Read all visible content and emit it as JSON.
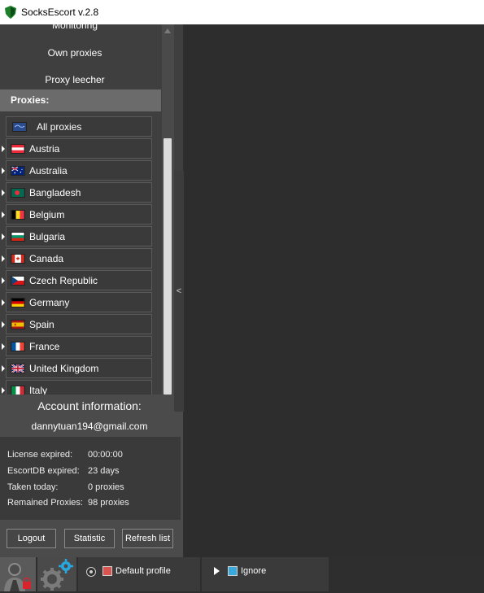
{
  "window": {
    "title": "SocksEscort v.2.8",
    "icon": "shield-icon"
  },
  "nav": {
    "items": [
      {
        "label": "Monitoring"
      },
      {
        "label": "Own proxies"
      },
      {
        "label": "Proxy leecher"
      }
    ]
  },
  "proxies": {
    "header": "Proxies:",
    "items": [
      {
        "label": "All proxies",
        "flag": "globe"
      },
      {
        "label": "Austria",
        "flag": "at"
      },
      {
        "label": "Australia",
        "flag": "au"
      },
      {
        "label": "Bangladesh",
        "flag": "bd"
      },
      {
        "label": "Belgium",
        "flag": "be"
      },
      {
        "label": "Bulgaria",
        "flag": "bg"
      },
      {
        "label": "Canada",
        "flag": "ca"
      },
      {
        "label": "Czech Republic",
        "flag": "cz"
      },
      {
        "label": "Germany",
        "flag": "de"
      },
      {
        "label": "Spain",
        "flag": "es"
      },
      {
        "label": "France",
        "flag": "fr"
      },
      {
        "label": "United Kingdom",
        "flag": "gb"
      },
      {
        "label": "Italy",
        "flag": "it"
      }
    ]
  },
  "splitter": {
    "glyph": "<"
  },
  "account": {
    "title": "Account information:",
    "email": "dannytuan194@gmail.com",
    "stats": [
      {
        "key": "License expired:",
        "value": "00:00:00"
      },
      {
        "key": "EscortDB expired:",
        "value": "23 days"
      },
      {
        "key": "Taken today:",
        "value": "0 proxies"
      },
      {
        "key": "Remained Proxies:",
        "value": "98 proxies"
      }
    ],
    "buttons": {
      "logout": "Logout",
      "statistic": "Statistic",
      "refresh": "Refresh list"
    }
  },
  "bottom": {
    "profile_label": "Default profile",
    "ignore_label": "Ignore"
  },
  "colors": {
    "panel_bg": "#3f3f3f",
    "content_bg": "#2d2d2d",
    "header_bg": "#6b6b6b",
    "profile_square": "#d9534f",
    "ignore_square": "#39a9db",
    "gear_accent": "#29a8e0",
    "lock_accent": "#d9232d"
  }
}
